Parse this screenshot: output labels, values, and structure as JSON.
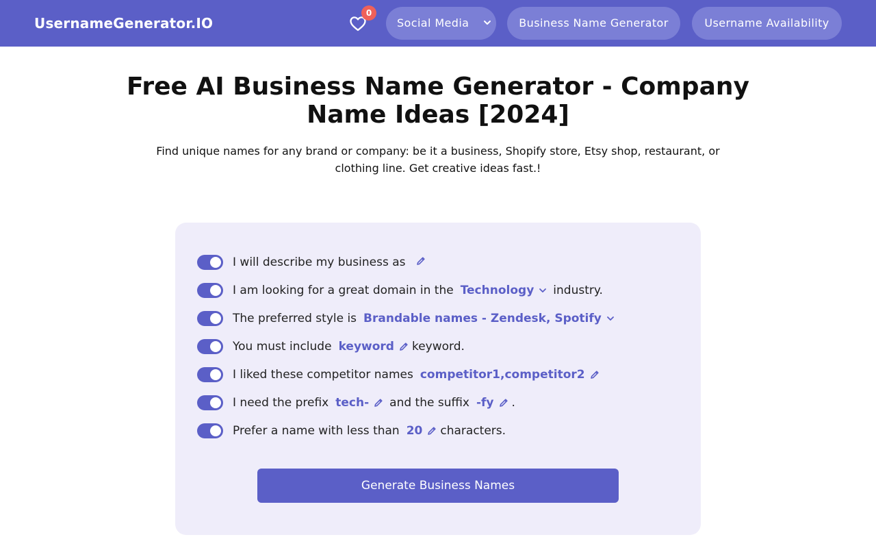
{
  "nav": {
    "brand": "UsernameGenerator.IO",
    "favorites_count": "0",
    "social_label": "Social Media",
    "business_label": "Business Name Generator",
    "availability_label": "Username Availability"
  },
  "hero": {
    "title": "Free AI Business Name Generator - Company Name Ideas [2024]",
    "subtitle": "Find unique names for any brand or company: be it a business, Shopify store, Etsy shop, restaurant, or clothing line. Get creative ideas fast.!"
  },
  "form": {
    "rows": [
      {
        "text": "I will describe my business as"
      },
      {
        "text": "I am looking for a great domain in the",
        "value": "Technology",
        "after": "industry."
      },
      {
        "text": "The preferred style is",
        "value": "Brandable names - Zendesk, Spotify"
      },
      {
        "text": "You must include",
        "value": "keyword",
        "after": "keyword."
      },
      {
        "text": "I liked these competitor names",
        "value": "competitor1,competitor2"
      },
      {
        "text": "I need the prefix",
        "value": "tech-",
        "middle": "and the suffix",
        "value2": "-fy",
        "after": "."
      },
      {
        "text": "Prefer a name with less than",
        "value": "20",
        "after": "characters."
      }
    ],
    "submit_label": "Generate Business Names"
  },
  "colors": {
    "brand": "#5b5fc7",
    "pill": "#7b7fd6",
    "card": "#efedfa",
    "badge": "#f0615a"
  },
  "icons": [
    "heart-icon",
    "chevron-down-icon",
    "pencil-icon"
  ]
}
